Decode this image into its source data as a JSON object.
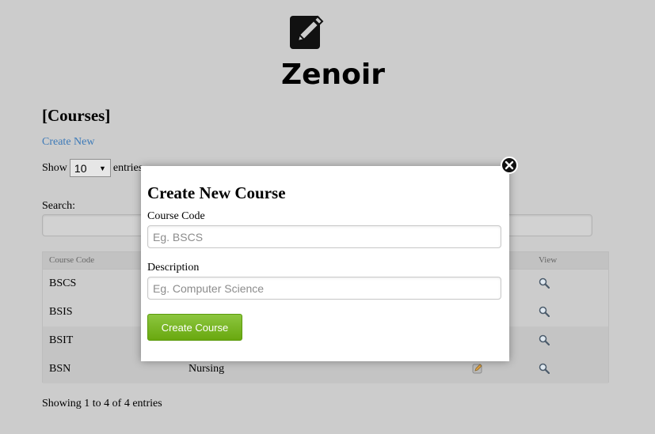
{
  "header": {
    "logo_icon": "edit-square-icon",
    "app_title": "Zenoir"
  },
  "section": {
    "heading": "[Courses]",
    "create_link": "Create New"
  },
  "length_control": {
    "show_label": "Show",
    "selected": "10",
    "entries_label": "entries"
  },
  "search": {
    "label": "Search:"
  },
  "table": {
    "headers": {
      "code": "Course Code",
      "view": "View"
    },
    "rows": [
      {
        "code": "BSCS",
        "description": ""
      },
      {
        "code": "BSIS",
        "description": ""
      },
      {
        "code": "BSIT",
        "description": ""
      },
      {
        "code": "BSN",
        "description": "Nursing"
      }
    ],
    "edit_icon": "edit-icon",
    "view_icon": "magnifier-icon"
  },
  "footer": {
    "showing": "Showing 1 to 4 of 4 entries"
  },
  "modal": {
    "title": "Create New Course",
    "code_label": "Course Code",
    "code_placeholder": "Eg. BSCS",
    "code_value": "",
    "description_label": "Description",
    "description_placeholder": "Eg. Computer Science",
    "description_value": "",
    "submit_label": "Create Course",
    "close_icon": "close-icon"
  },
  "colors": {
    "background": "#cccccc",
    "link": "#3d7ab8",
    "button": "#76b41c"
  }
}
